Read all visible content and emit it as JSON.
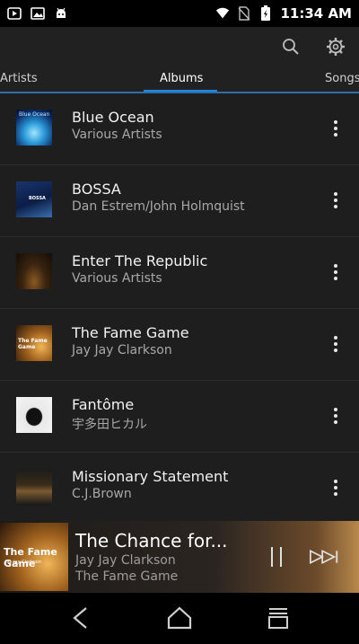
{
  "status_bar": {
    "time": "11:34 AM",
    "icons": [
      "play-store-icon",
      "image-icon",
      "android-icon",
      "wifi-icon",
      "no-sim-icon",
      "battery-icon"
    ]
  },
  "app_bar": {
    "icons": [
      "search-icon",
      "gear-icon"
    ]
  },
  "tabs": [
    {
      "label": "Artists",
      "active": false
    },
    {
      "label": "Albums",
      "active": true
    },
    {
      "label": "Songs",
      "active": false
    }
  ],
  "albums": [
    {
      "title": "Blue Ocean",
      "artist": "Various Artists",
      "art_label": "Blue Ocean"
    },
    {
      "title": "BOSSA",
      "artist": "Dan Estrem/John Holmquist",
      "art_label": "BOSSA"
    },
    {
      "title": "Enter The Republic",
      "artist": "Various Artists"
    },
    {
      "title": "The Fame Game",
      "artist": "Jay Jay Clarkson",
      "art_label": "The Fame Game"
    },
    {
      "title": "Fantôme",
      "artist": "宇多田ヒカル"
    },
    {
      "title": "Missionary Statement",
      "artist": "C.J.Brown"
    }
  ],
  "now_playing": {
    "title": "The Chance for...",
    "artist": "Jay Jay Clarkson",
    "album": "The Fame Game",
    "art_label": "The Fame Game",
    "art_sublabel": "Jay Jay Clarkson"
  },
  "colors": {
    "accent": "#1e88e5",
    "background": "#1e1e1e",
    "app_bar": "#212121"
  }
}
